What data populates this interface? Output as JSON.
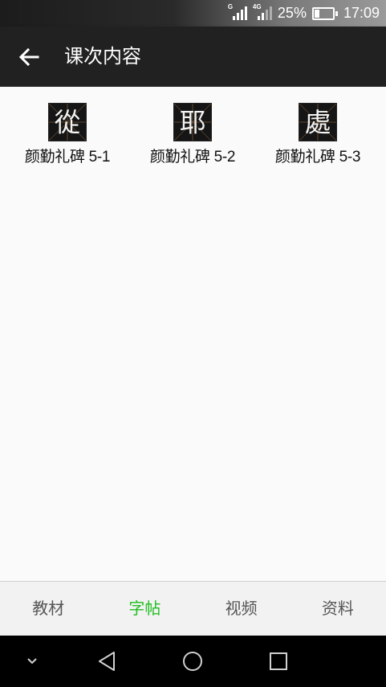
{
  "status_bar": {
    "network_1": "G",
    "network_2": "4G",
    "battery_percent_text": "25%",
    "battery_level": 0.25,
    "time": "17:09"
  },
  "app_bar": {
    "back_icon": "arrow-left-icon",
    "title": "课次内容"
  },
  "items": [
    {
      "label": "颜勤礼碑 5-1",
      "thumbnail_char": "從"
    },
    {
      "label": "颜勤礼碑 5-2",
      "thumbnail_char": "耶"
    },
    {
      "label": "颜勤礼碑 5-3",
      "thumbnail_char": "處"
    }
  ],
  "tabs": [
    {
      "label": "教材",
      "active": false
    },
    {
      "label": "字帖",
      "active": true
    },
    {
      "label": "视频",
      "active": false
    },
    {
      "label": "资料",
      "active": false
    }
  ],
  "colors": {
    "app_bar": "#212121",
    "active_tab": "#1fbe1f",
    "inactive_tab": "#555555",
    "background": "#fafafa"
  },
  "nav_bar": {
    "icons": [
      "chevron-down-icon",
      "back-triangle-icon",
      "home-circle-icon",
      "recents-square-icon"
    ]
  }
}
